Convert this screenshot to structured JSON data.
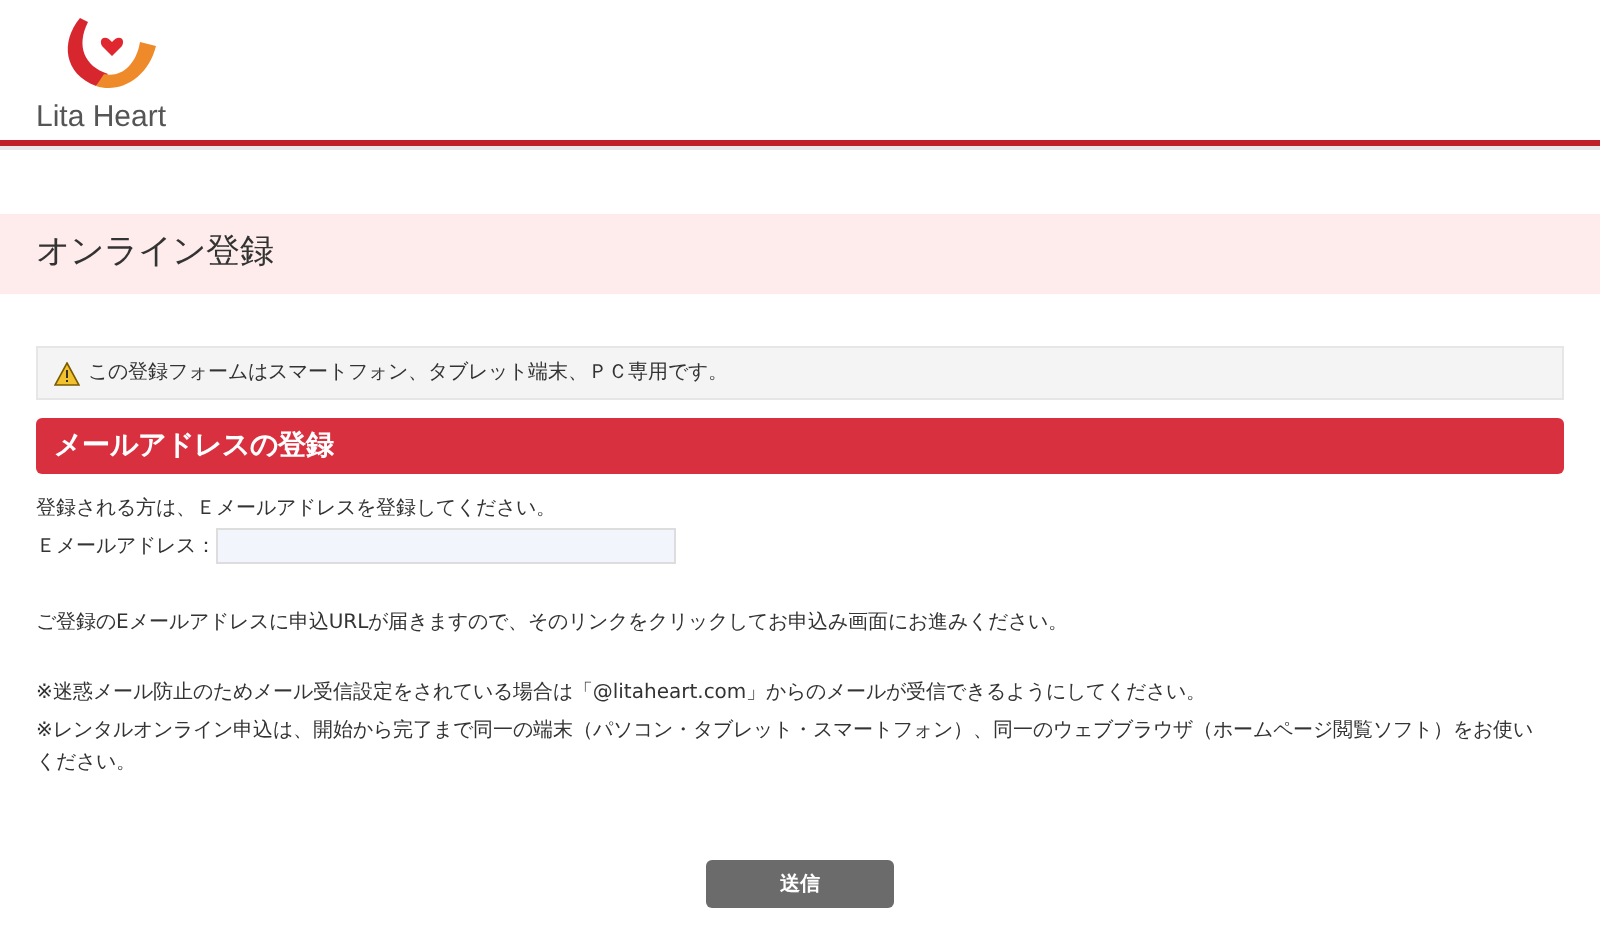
{
  "header": {
    "logo_text": "Lita Heart"
  },
  "page_title": "オンライン登録",
  "notice": "この登録フォームはスマートフォン、タブレット端末、ＰＣ専用です。",
  "section_title": "メールアドレスの登録",
  "intro": "登録される方は、Ｅメールアドレスを登録してください。",
  "email_field": {
    "label": "Ｅメールアドレス："
  },
  "info": "ご登録のEメールアドレスに申込URLが届きますので、そのリンクをクリックしてお申込み画面にお進みください。",
  "notes": [
    "※迷惑メール防止のためメール受信設定をされている場合は「@litaheart.com」からのメールが受信できるようにしてください。",
    "※レンタルオンライン申込は、開始から完了まで同一の端末（パソコン・タブレット・スマートフォン）、同一のウェブブラウザ（ホームページ閲覧ソフト）をお使いください。"
  ],
  "submit_button": "送信"
}
